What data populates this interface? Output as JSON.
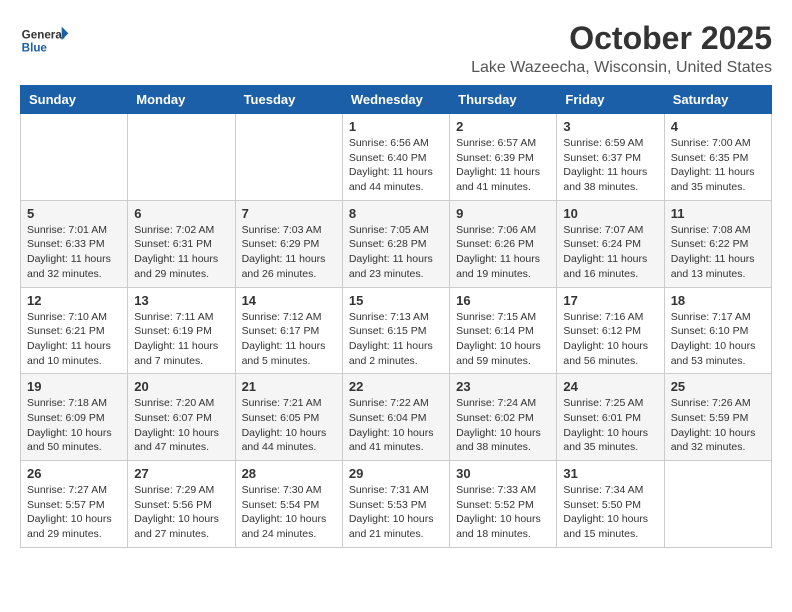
{
  "header": {
    "logo_general": "General",
    "logo_blue": "Blue",
    "title": "October 2025",
    "subtitle": "Lake Wazeecha, Wisconsin, United States"
  },
  "weekdays": [
    "Sunday",
    "Monday",
    "Tuesday",
    "Wednesday",
    "Thursday",
    "Friday",
    "Saturday"
  ],
  "weeks": [
    [
      {
        "day": "",
        "info": ""
      },
      {
        "day": "",
        "info": ""
      },
      {
        "day": "",
        "info": ""
      },
      {
        "day": "1",
        "info": "Sunrise: 6:56 AM\nSunset: 6:40 PM\nDaylight: 11 hours\nand 44 minutes."
      },
      {
        "day": "2",
        "info": "Sunrise: 6:57 AM\nSunset: 6:39 PM\nDaylight: 11 hours\nand 41 minutes."
      },
      {
        "day": "3",
        "info": "Sunrise: 6:59 AM\nSunset: 6:37 PM\nDaylight: 11 hours\nand 38 minutes."
      },
      {
        "day": "4",
        "info": "Sunrise: 7:00 AM\nSunset: 6:35 PM\nDaylight: 11 hours\nand 35 minutes."
      }
    ],
    [
      {
        "day": "5",
        "info": "Sunrise: 7:01 AM\nSunset: 6:33 PM\nDaylight: 11 hours\nand 32 minutes."
      },
      {
        "day": "6",
        "info": "Sunrise: 7:02 AM\nSunset: 6:31 PM\nDaylight: 11 hours\nand 29 minutes."
      },
      {
        "day": "7",
        "info": "Sunrise: 7:03 AM\nSunset: 6:29 PM\nDaylight: 11 hours\nand 26 minutes."
      },
      {
        "day": "8",
        "info": "Sunrise: 7:05 AM\nSunset: 6:28 PM\nDaylight: 11 hours\nand 23 minutes."
      },
      {
        "day": "9",
        "info": "Sunrise: 7:06 AM\nSunset: 6:26 PM\nDaylight: 11 hours\nand 19 minutes."
      },
      {
        "day": "10",
        "info": "Sunrise: 7:07 AM\nSunset: 6:24 PM\nDaylight: 11 hours\nand 16 minutes."
      },
      {
        "day": "11",
        "info": "Sunrise: 7:08 AM\nSunset: 6:22 PM\nDaylight: 11 hours\nand 13 minutes."
      }
    ],
    [
      {
        "day": "12",
        "info": "Sunrise: 7:10 AM\nSunset: 6:21 PM\nDaylight: 11 hours\nand 10 minutes."
      },
      {
        "day": "13",
        "info": "Sunrise: 7:11 AM\nSunset: 6:19 PM\nDaylight: 11 hours\nand 7 minutes."
      },
      {
        "day": "14",
        "info": "Sunrise: 7:12 AM\nSunset: 6:17 PM\nDaylight: 11 hours\nand 5 minutes."
      },
      {
        "day": "15",
        "info": "Sunrise: 7:13 AM\nSunset: 6:15 PM\nDaylight: 11 hours\nand 2 minutes."
      },
      {
        "day": "16",
        "info": "Sunrise: 7:15 AM\nSunset: 6:14 PM\nDaylight: 10 hours\nand 59 minutes."
      },
      {
        "day": "17",
        "info": "Sunrise: 7:16 AM\nSunset: 6:12 PM\nDaylight: 10 hours\nand 56 minutes."
      },
      {
        "day": "18",
        "info": "Sunrise: 7:17 AM\nSunset: 6:10 PM\nDaylight: 10 hours\nand 53 minutes."
      }
    ],
    [
      {
        "day": "19",
        "info": "Sunrise: 7:18 AM\nSunset: 6:09 PM\nDaylight: 10 hours\nand 50 minutes."
      },
      {
        "day": "20",
        "info": "Sunrise: 7:20 AM\nSunset: 6:07 PM\nDaylight: 10 hours\nand 47 minutes."
      },
      {
        "day": "21",
        "info": "Sunrise: 7:21 AM\nSunset: 6:05 PM\nDaylight: 10 hours\nand 44 minutes."
      },
      {
        "day": "22",
        "info": "Sunrise: 7:22 AM\nSunset: 6:04 PM\nDaylight: 10 hours\nand 41 minutes."
      },
      {
        "day": "23",
        "info": "Sunrise: 7:24 AM\nSunset: 6:02 PM\nDaylight: 10 hours\nand 38 minutes."
      },
      {
        "day": "24",
        "info": "Sunrise: 7:25 AM\nSunset: 6:01 PM\nDaylight: 10 hours\nand 35 minutes."
      },
      {
        "day": "25",
        "info": "Sunrise: 7:26 AM\nSunset: 5:59 PM\nDaylight: 10 hours\nand 32 minutes."
      }
    ],
    [
      {
        "day": "26",
        "info": "Sunrise: 7:27 AM\nSunset: 5:57 PM\nDaylight: 10 hours\nand 29 minutes."
      },
      {
        "day": "27",
        "info": "Sunrise: 7:29 AM\nSunset: 5:56 PM\nDaylight: 10 hours\nand 27 minutes."
      },
      {
        "day": "28",
        "info": "Sunrise: 7:30 AM\nSunset: 5:54 PM\nDaylight: 10 hours\nand 24 minutes."
      },
      {
        "day": "29",
        "info": "Sunrise: 7:31 AM\nSunset: 5:53 PM\nDaylight: 10 hours\nand 21 minutes."
      },
      {
        "day": "30",
        "info": "Sunrise: 7:33 AM\nSunset: 5:52 PM\nDaylight: 10 hours\nand 18 minutes."
      },
      {
        "day": "31",
        "info": "Sunrise: 7:34 AM\nSunset: 5:50 PM\nDaylight: 10 hours\nand 15 minutes."
      },
      {
        "day": "",
        "info": ""
      }
    ]
  ]
}
